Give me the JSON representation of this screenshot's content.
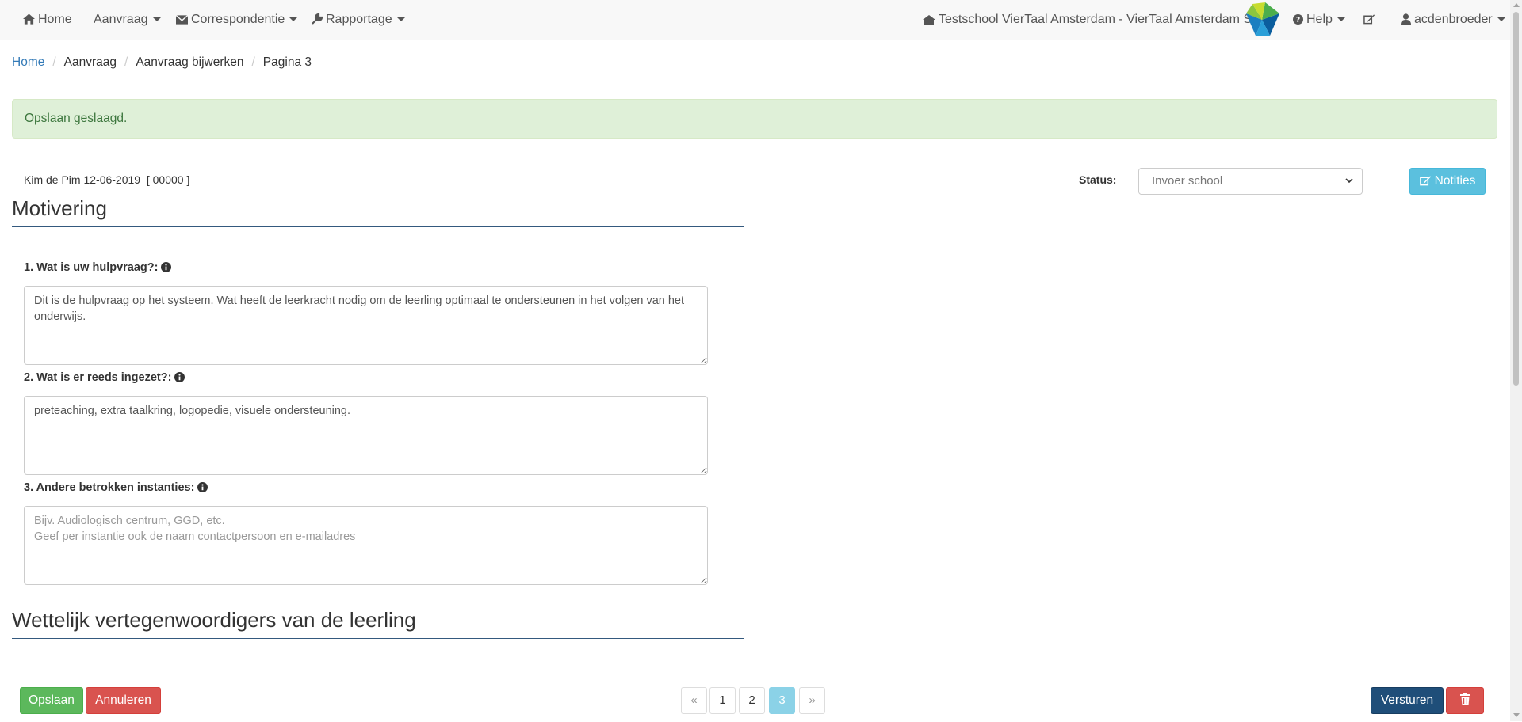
{
  "nav": {
    "home": "Home",
    "aanvraag": "Aanvraag",
    "correspondentie": "Correspondentie",
    "rapportage": "Rapportage",
    "school": "Testschool VierTaal Amsterdam - VierTaal Amsterdam SO",
    "help": "Help",
    "user": "acdenbroeder",
    "icons": [
      "home-icon",
      "envelope-icon",
      "wrench-icon",
      "school-icon",
      "help-icon",
      "edit-icon",
      "user-icon"
    ]
  },
  "breadcrumb": {
    "home": "Home",
    "aanvraag": "Aanvraag",
    "bijwerken": "Aanvraag bijwerken",
    "pagina": "Pagina 3",
    "separator": "/"
  },
  "alert": {
    "message": "Opslaan geslaagd."
  },
  "header": {
    "student": "Kim de Pim 12-06-2019  [ 00000 ]",
    "status_label": "Status:",
    "status_value": "Invoer school",
    "notities": "Notities"
  },
  "motivering": {
    "title": "Motivering",
    "questions": [
      {
        "label": "1. Wat is uw hulpvraag?:",
        "value": "Dit is de hulpvraag op het systeem. Wat heeft de leerkracht nodig om de leerling optimaal te ondersteunen in het volgen van het onderwijs.",
        "placeholder": ""
      },
      {
        "label": "2. Wat is er reeds ingezet?:",
        "value": "preteaching, extra taalkring, logopedie, visuele ondersteuning.",
        "placeholder": ""
      },
      {
        "label": "3. Andere betrokken instanties:",
        "value": "",
        "placeholder": "Bijv. Audiologisch centrum, GGD, etc.\nGeef per instantie ook de naam contactpersoon en e-mailadres"
      }
    ]
  },
  "vertegenwoordigers": {
    "title": "Wettelijk vertegenwoordigers van de leerling"
  },
  "footer": {
    "save": "Opslaan",
    "cancel": "Annuleren",
    "send": "Versturen",
    "pagination": {
      "prev": "«",
      "pages": [
        "1",
        "2",
        "3"
      ],
      "active_page": "3",
      "next": "»"
    }
  },
  "colors": {
    "primary": "#1f4e79",
    "success": "#5cb85c",
    "danger": "#d9534f",
    "info": "#5bc0de",
    "link": "#337ab7",
    "alert_bg": "#dff0d8",
    "alert_text": "#3c763d"
  }
}
